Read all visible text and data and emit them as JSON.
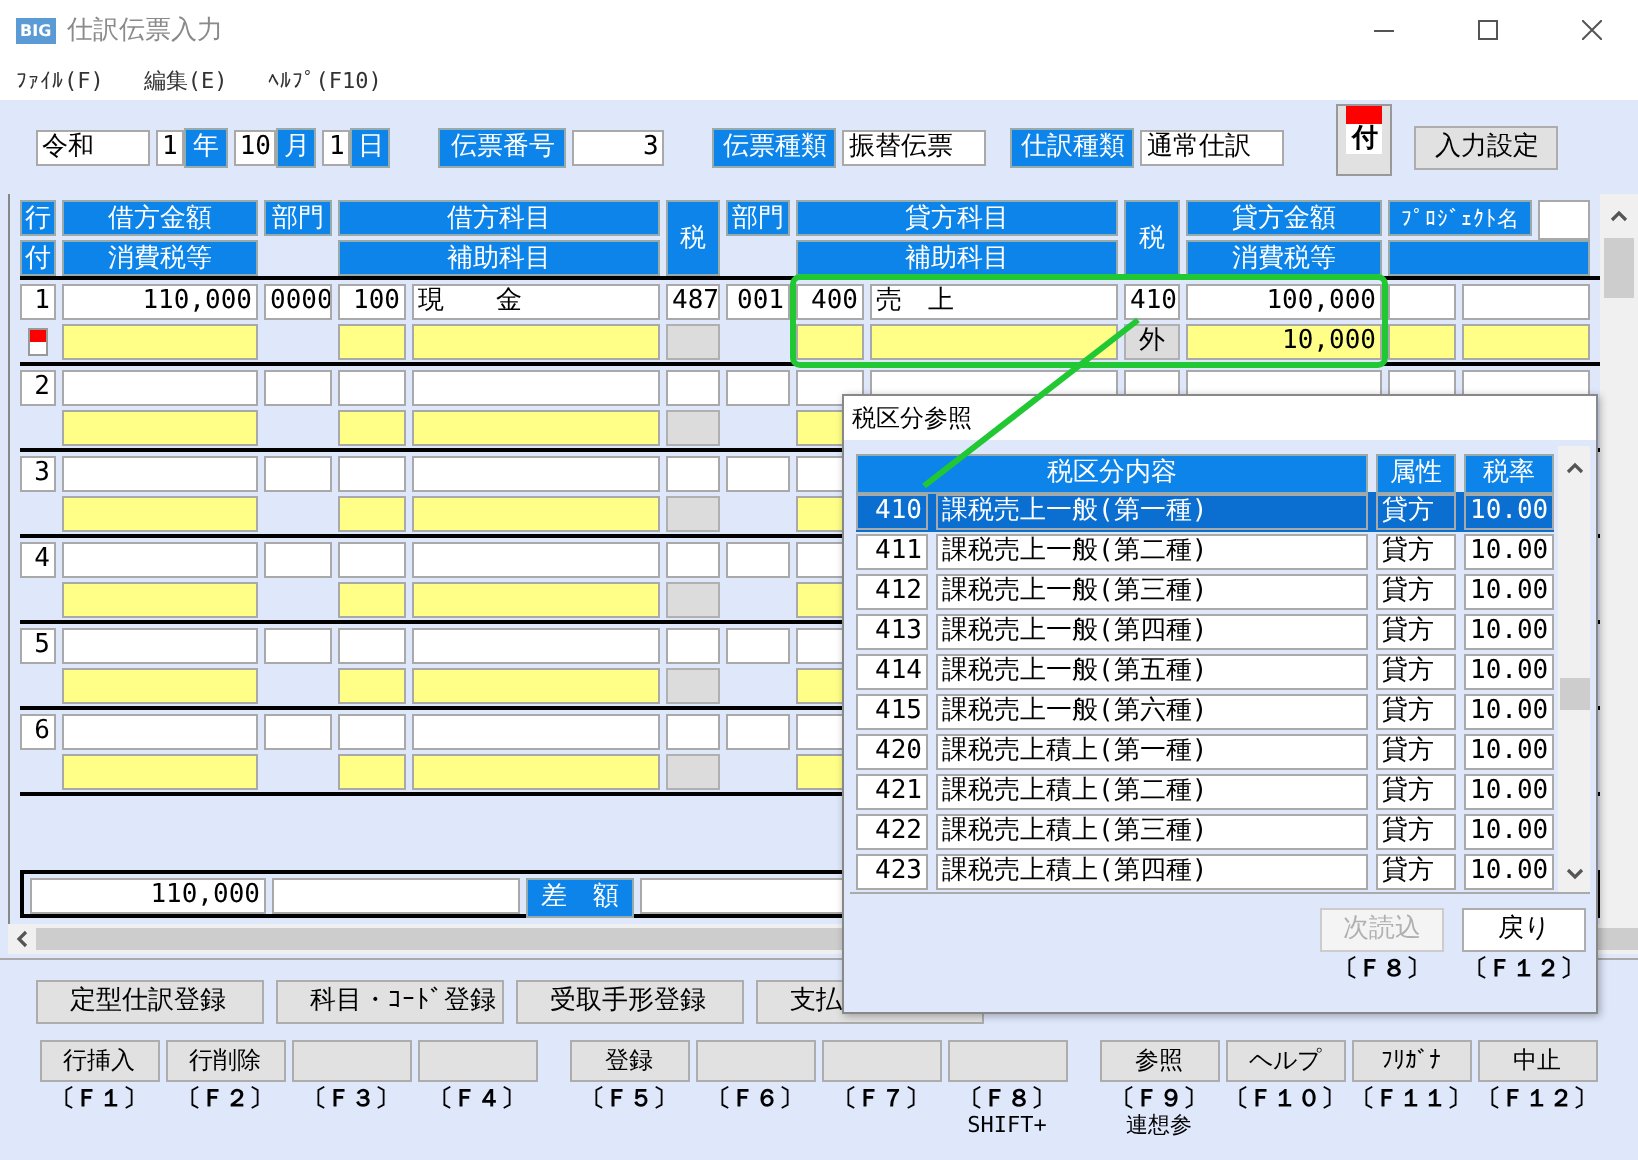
{
  "window": {
    "logo": "BIG",
    "title": "仕訳伝票入力"
  },
  "menu": [
    "ﾌｧｲﾙ(F)",
    "編集(E)",
    "ﾍﾙﾌﾟ(F10)"
  ],
  "header": {
    "era": "令和",
    "year": "1",
    "year_label": "年",
    "month": "10",
    "month_label": "月",
    "day": "1",
    "day_label": "日",
    "slip_no_label": "伝票番号",
    "slip_no": "3",
    "slip_type_label": "伝票種類",
    "slip_type": "振替伝票",
    "entry_type_label": "仕訳種類",
    "entry_type": "通常仕訳",
    "attach_label": "付",
    "settings_button": "入力設定"
  },
  "grid": {
    "headers": {
      "line": "行",
      "attach": "付",
      "debit_amount": "借方金額",
      "debit_tax_amount": "消費税等",
      "debit_dept": "部門",
      "debit_account": "借方科目",
      "debit_sub": "補助科目",
      "debit_tax": "税",
      "credit_dept": "部門",
      "credit_account": "貸方科目",
      "credit_sub": "補助科目",
      "credit_tax": "税",
      "credit_amount": "貸方金額",
      "credit_tax_amount": "消費税等",
      "project": "ﾌﾟﾛｼﾞｪｸﾄ名"
    },
    "rows": [
      {
        "no": "1",
        "flagged": true,
        "highlighted": true,
        "debit_amount": "110,000",
        "debit_dept": "0000",
        "debit_code": "100",
        "debit_account": "現　　金",
        "debit_tax": "487",
        "credit_dept": "001",
        "credit_code": "400",
        "credit_account": "売　上",
        "credit_tax": "410",
        "credit_amount": "100,000",
        "credit_tax_type": "外",
        "credit_tax_amount": "10,000"
      },
      {
        "no": "2",
        "flagged": false,
        "highlighted": false
      },
      {
        "no": "3",
        "flagged": false,
        "highlighted": false
      },
      {
        "no": "4",
        "flagged": false,
        "highlighted": false
      },
      {
        "no": "5",
        "flagged": false,
        "highlighted": false
      },
      {
        "no": "6",
        "flagged": false,
        "highlighted": false
      }
    ],
    "totals": {
      "debit_total": "110,000",
      "diff_label": "差　額"
    }
  },
  "func_buttons": [
    "定型仕訳登録",
    "科目・ｺｰﾄﾞ登録",
    "受取手形登録",
    "支払"
  ],
  "fkeys": [
    {
      "label": "行挿入",
      "key": "〔Ｆ１〕"
    },
    {
      "label": "行削除",
      "key": "〔Ｆ２〕"
    },
    {
      "key": "〔Ｆ３〕"
    },
    {
      "key": "〔Ｆ４〕"
    },
    {
      "label": "登録",
      "key": "〔Ｆ５〕"
    },
    {
      "key": "〔Ｆ６〕"
    },
    {
      "key": "〔Ｆ７〕"
    },
    {
      "key": "〔Ｆ８〕",
      "note": "SHIFT+"
    },
    {
      "label": "参照",
      "key": "〔Ｆ９〕",
      "note": "連想参"
    },
    {
      "label": "ヘルプ",
      "key": "〔Ｆ１０〕"
    },
    {
      "label": "ﾌﾘｶﾞﾅ",
      "key": "〔Ｆ１１〕"
    },
    {
      "label": "中止",
      "key": "〔Ｆ１２〕"
    }
  ],
  "dialog": {
    "title": "税区分参照",
    "columns": [
      "税区分内容",
      "属性",
      "税率"
    ],
    "rows": [
      {
        "code": "410",
        "name": "課税売上一般(第一種)",
        "attr": "貸方",
        "rate": "10.00",
        "selected": true
      },
      {
        "code": "411",
        "name": "課税売上一般(第二種)",
        "attr": "貸方",
        "rate": "10.00",
        "selected": false
      },
      {
        "code": "412",
        "name": "課税売上一般(第三種)",
        "attr": "貸方",
        "rate": "10.00",
        "selected": false
      },
      {
        "code": "413",
        "name": "課税売上一般(第四種)",
        "attr": "貸方",
        "rate": "10.00",
        "selected": false
      },
      {
        "code": "414",
        "name": "課税売上一般(第五種)",
        "attr": "貸方",
        "rate": "10.00",
        "selected": false
      },
      {
        "code": "415",
        "name": "課税売上一般(第六種)",
        "attr": "貸方",
        "rate": "10.00",
        "selected": false
      },
      {
        "code": "420",
        "name": "課税売上積上(第一種)",
        "attr": "貸方",
        "rate": "10.00",
        "selected": false
      },
      {
        "code": "421",
        "name": "課税売上積上(第二種)",
        "attr": "貸方",
        "rate": "10.00",
        "selected": false
      },
      {
        "code": "422",
        "name": "課税売上積上(第三種)",
        "attr": "貸方",
        "rate": "10.00",
        "selected": false
      },
      {
        "code": "423",
        "name": "課税売上積上(第四種)",
        "attr": "貸方",
        "rate": "10.00",
        "selected": false
      }
    ],
    "buttons": [
      {
        "label": "次読込",
        "key": "〔Ｆ８〕",
        "disabled": true
      },
      {
        "label": "戻り",
        "key": "〔Ｆ１２〕",
        "disabled": false
      }
    ]
  }
}
